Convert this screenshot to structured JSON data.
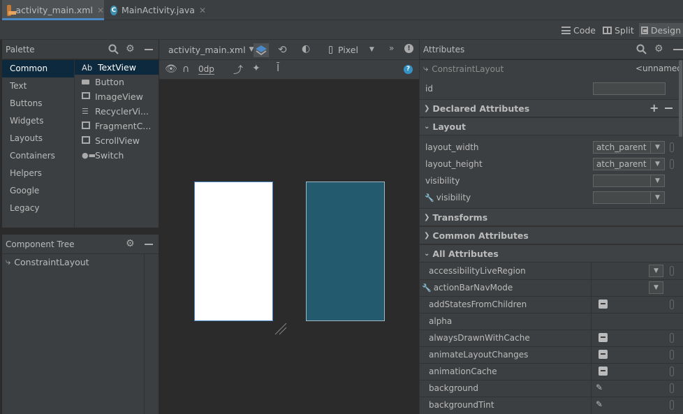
{
  "tabs": [
    {
      "label": "activity_main.xml",
      "icon": "xml-file-icon",
      "active": true
    },
    {
      "label": "MainActivity.java",
      "icon": "java-class-icon",
      "active": false
    }
  ],
  "view_modes": {
    "code": "Code",
    "split": "Split",
    "design": "Design",
    "active": "Design"
  },
  "palette": {
    "title": "Palette",
    "categories": [
      "Common",
      "Text",
      "Buttons",
      "Widgets",
      "Layouts",
      "Containers",
      "Helpers",
      "Google",
      "Legacy"
    ],
    "selected_category": "Common",
    "items": [
      {
        "label": "TextView",
        "icon": "textview-icon",
        "glyph": "Ab"
      },
      {
        "label": "Button",
        "icon": "button-icon"
      },
      {
        "label": "ImageView",
        "icon": "imageview-icon"
      },
      {
        "label": "RecyclerVi...",
        "icon": "recyclerview-icon"
      },
      {
        "label": "FragmentC...",
        "icon": "fragmentcontainer-icon"
      },
      {
        "label": "ScrollView",
        "icon": "scrollview-icon"
      },
      {
        "label": "Switch",
        "icon": "switch-icon"
      }
    ]
  },
  "component_tree": {
    "title": "Component Tree",
    "root": "ConstraintLayout"
  },
  "design_toolbar": {
    "file": "activity_main.xml",
    "device": "Pixel",
    "margin": "0dp"
  },
  "attributes": {
    "title": "Attributes",
    "component": "ConstraintLayout",
    "component_id": "<unnamed>",
    "id_label": "id",
    "id_value": "",
    "sections": {
      "declared": "Declared Attributes",
      "layout": "Layout",
      "transforms": "Transforms",
      "common": "Common Attributes",
      "all": "All Attributes"
    },
    "layout_rows": [
      {
        "name": "layout_width",
        "value": "atch_parent"
      },
      {
        "name": "layout_height",
        "value": "atch_parent"
      },
      {
        "name": "visibility",
        "value": ""
      },
      {
        "name": "visibility",
        "value": "",
        "tool": true
      }
    ],
    "all_rows": [
      {
        "name": "accessibilityLiveRegion",
        "control": "dropdown"
      },
      {
        "name": "actionBarNavMode",
        "control": "dropdown",
        "tool": true
      },
      {
        "name": "addStatesFromChildren",
        "control": "flag"
      },
      {
        "name": "alpha",
        "control": "none"
      },
      {
        "name": "alwaysDrawnWithCache",
        "control": "flag"
      },
      {
        "name": "animateLayoutChanges",
        "control": "flag"
      },
      {
        "name": "animationCache",
        "control": "flag"
      },
      {
        "name": "background",
        "control": "picker"
      },
      {
        "name": "backgroundTint",
        "control": "picker"
      }
    ]
  },
  "colors": {
    "design_surface": "#ffffff",
    "blueprint_surface": "#235a6e",
    "selection": "#0d293e",
    "accent": "#4a88c7"
  }
}
